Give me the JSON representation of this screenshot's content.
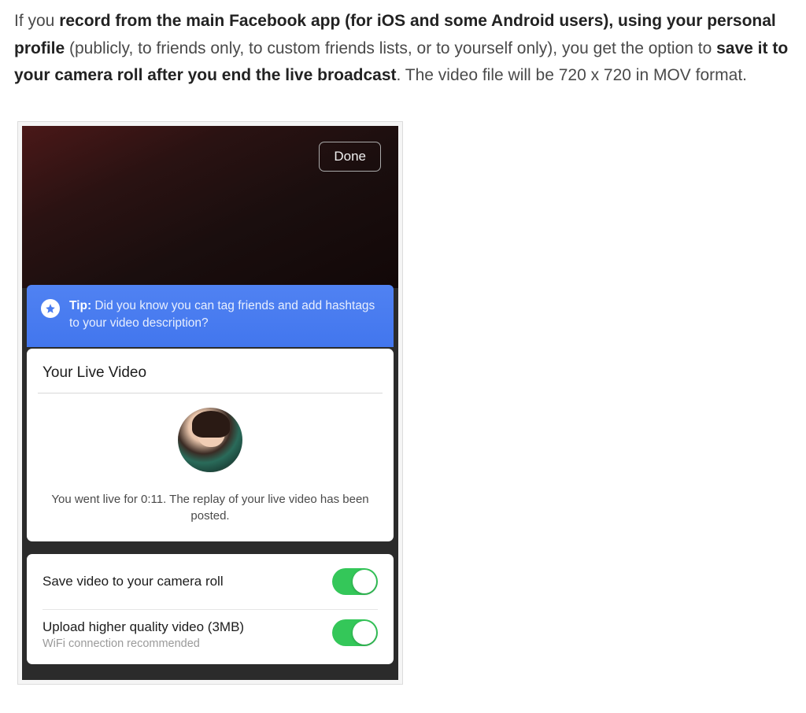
{
  "article": {
    "p1_prefix": "If you ",
    "p1_bold1": "record from the main Facebook app (for iOS and some Android users), using your personal profile",
    "p1_mid1": " (publicly, to friends only, to custom friends lists, or to yourself only), you get the option to ",
    "p1_bold2": "save it to your camera roll after you end the live broadcast",
    "p1_suffix": ". The video file will be 720 x 720 in MOV format."
  },
  "screenshot": {
    "done_label": "Done",
    "tip": {
      "label": "Tip:",
      "body": " Did you know you can tag friends and add hashtags to your video description?"
    },
    "live_card": {
      "title": "Your Live Video",
      "summary": "You went live for 0:11. The replay of your live video has been posted."
    },
    "settings": {
      "save_label": "Save video to your camera roll",
      "hq_label": "Upload higher quality video (3MB)",
      "hq_sub": "WiFi connection recommended"
    }
  }
}
